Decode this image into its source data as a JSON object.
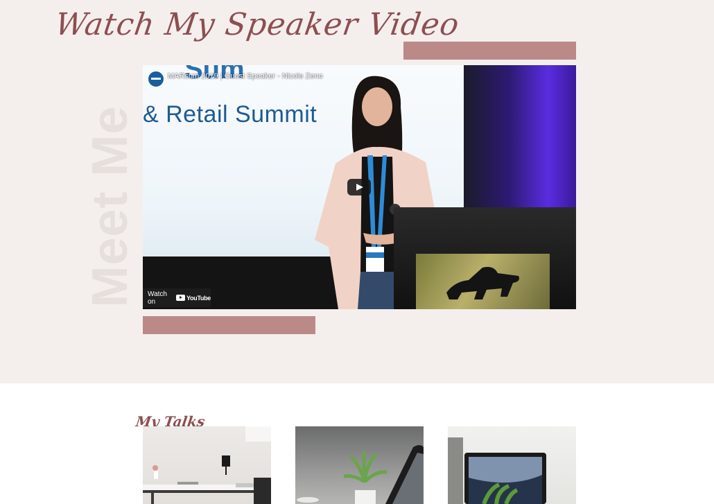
{
  "hero": {
    "title": "Watch My Speaker Video",
    "vertical_label": "Meet Me",
    "accent_color": "#bb8a88",
    "title_color": "#8d4f52",
    "background_color": "#f4efed"
  },
  "video": {
    "title": "MARsum 2019 | Guest Speaker - Nicole Zeno",
    "screen_heading": "& Retail Summit",
    "screen_heading_partial": "Sum",
    "watch_on_label": "Watch on",
    "platform_label": "YouTube",
    "play_icon": "play-icon"
  },
  "talks": {
    "title": "My Talks",
    "cards": [
      {
        "name": "desk-workspace-image"
      },
      {
        "name": "plant-laptop-image"
      },
      {
        "name": "laptop-earth-image"
      }
    ]
  }
}
